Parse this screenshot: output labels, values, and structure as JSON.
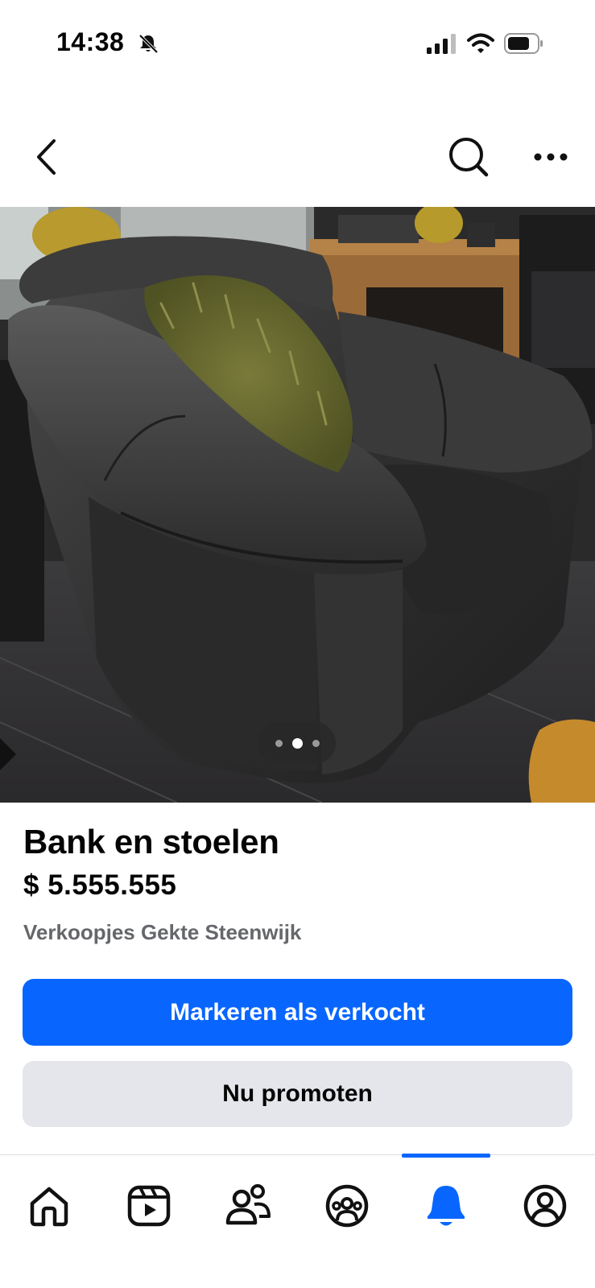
{
  "status_bar": {
    "time": "14:38",
    "icons": [
      "bell-slash-icon",
      "cellular-signal-icon",
      "wifi-icon",
      "battery-icon"
    ]
  },
  "nav": {
    "icons": [
      "chevron-left-icon",
      "search-icon",
      "more-horizontal-icon"
    ]
  },
  "photo": {
    "subject": "black leather armchair with green fluffy cushion",
    "pager": {
      "count": 3,
      "active_index": 1
    }
  },
  "listing": {
    "title": "Bank en stoelen",
    "price": "$ 5.555.555",
    "group": "Verkoopjes Gekte Steenwijk"
  },
  "actions": {
    "mark_sold": "Markeren als verkocht",
    "promote": "Nu promoten"
  },
  "tabs": [
    {
      "name": "home",
      "icon": "home-icon",
      "active": false
    },
    {
      "name": "video",
      "icon": "video-icon",
      "active": false
    },
    {
      "name": "friends",
      "icon": "friends-icon",
      "active": false
    },
    {
      "name": "groups",
      "icon": "groups-icon",
      "active": false
    },
    {
      "name": "notifications",
      "icon": "bell-icon",
      "active": true
    },
    {
      "name": "profile",
      "icon": "profile-icon",
      "active": false
    }
  ],
  "colors": {
    "accent": "#0866ff",
    "secondary_button": "#e4e6eb",
    "muted_text": "#65676b"
  }
}
